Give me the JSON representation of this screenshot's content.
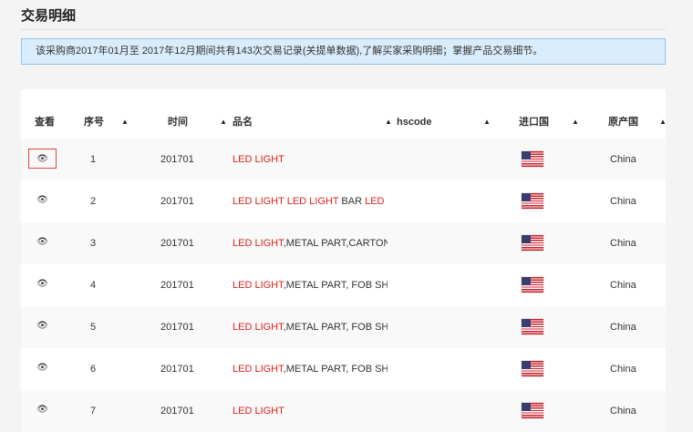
{
  "page": {
    "title": "交易明细",
    "notice": "该采购商2017年01月至 2017年12月期间共有143次交易记录(关提单数据),了解买家采购明细；掌握产品交易细节。"
  },
  "table": {
    "headers": {
      "view": "查看",
      "seq": "序号",
      "time": "时间",
      "name": "品名",
      "hscode": "hscode",
      "import": "进口国",
      "origin": "原产国"
    },
    "sort_glyph": "▲",
    "view_icon": "eye-icon",
    "rows": [
      {
        "seq": "1",
        "time": "201701",
        "name_hl": "LED LIGHT",
        "name_rest": "",
        "origin": "China",
        "flag": "us-flag"
      },
      {
        "seq": "2",
        "time": "201701",
        "name_hl": "LED LIGHT LED LIGHT",
        "name_rest": " BAR ",
        "name_hl2": "LED ...",
        "origin": "China",
        "flag": "us-flag"
      },
      {
        "seq": "3",
        "time": "201701",
        "name_hl": "LED LIGHT",
        "name_rest": ",METAL PART,CARTON...",
        "origin": "China",
        "flag": "us-flag"
      },
      {
        "seq": "4",
        "time": "201701",
        "name_hl": "LED LIGHT",
        "name_rest": ",METAL PART, FOB SH...",
        "origin": "China",
        "flag": "us-flag"
      },
      {
        "seq": "5",
        "time": "201701",
        "name_hl": "LED LIGHT",
        "name_rest": ",METAL PART, FOB SH...",
        "origin": "China",
        "flag": "us-flag"
      },
      {
        "seq": "6",
        "time": "201701",
        "name_hl": "LED LIGHT",
        "name_rest": ",METAL PART, FOB SH...",
        "origin": "China",
        "flag": "us-flag"
      },
      {
        "seq": "7",
        "time": "201701",
        "name_hl": "LED LIGHT",
        "name_rest": "",
        "origin": "China",
        "flag": "us-flag"
      }
    ]
  }
}
